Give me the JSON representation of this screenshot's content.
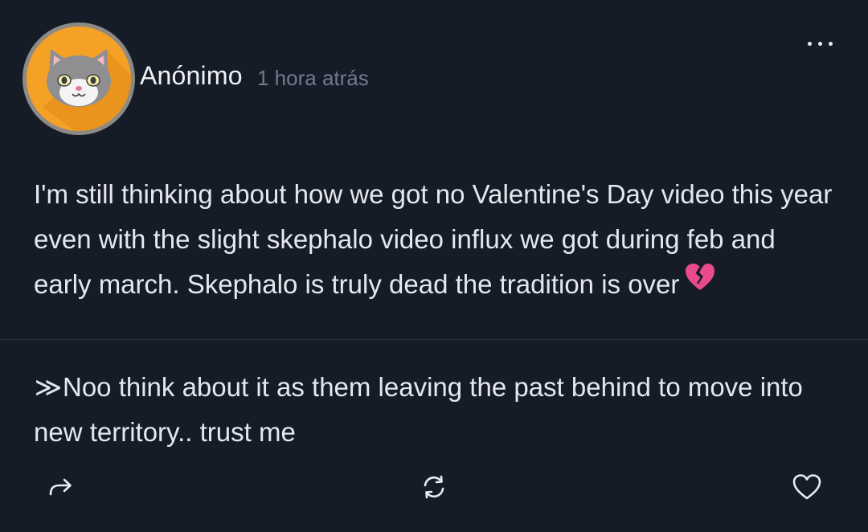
{
  "post": {
    "author": "Anónimo",
    "timestamp": "1 hora atrás",
    "body": "I'm still thinking about how we got no Valentine's Day video this year even with the slight skephalo video influx we got during feb and early march. Skephalo is truly dead the tradition is over",
    "body_emoji": "broken-heart-icon"
  },
  "reply": {
    "marker": "≫",
    "text": "Noo think about it as them leaving the past behind to move into new territory.. trust me"
  },
  "actions": {
    "share_icon": "share-arrow-icon",
    "repost_icon": "repost-icon",
    "like_icon": "heart-outline-icon"
  },
  "colors": {
    "background": "#161c27",
    "avatar_background": "#f5a126",
    "text": "#e4e8ee",
    "muted": "#6f7b8b",
    "divider": "#2a3240",
    "emoji": "#e94b8a"
  }
}
